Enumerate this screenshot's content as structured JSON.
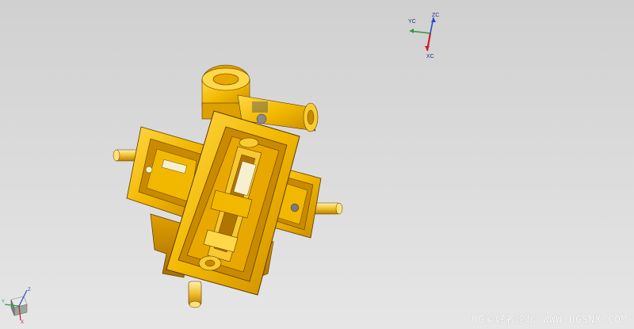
{
  "viewport": {
    "background_top": "#d0d0d0",
    "background_bottom": "#e6e6e6"
  },
  "model": {
    "color": "#f2b800",
    "shade_color": "#c98a00",
    "highlight_color": "#ffd84a",
    "edge_color": "#5a3a00"
  },
  "wcs": {
    "yc_label": "YC",
    "zc_label": "ZC",
    "xc_label": "XC",
    "yc_color": "#2e9a3a",
    "zc_color": "#2a4bc8",
    "xc_color": "#c8202a"
  },
  "triad": {
    "x_label": "X",
    "y_label": "Y",
    "z_label": "Z"
  },
  "watermark": {
    "text": "UG爱好者论坛 WWW.UGSNX.COM"
  }
}
